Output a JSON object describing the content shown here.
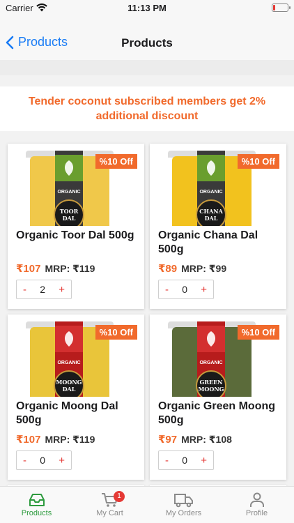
{
  "status": {
    "carrier": "Carrier",
    "time": "11:13 PM"
  },
  "nav": {
    "back_label": "Products",
    "title": "Products"
  },
  "banner": {
    "text": "Tender coconut subscribed members get 2% additional discount"
  },
  "products": [
    {
      "name": "Organic Toor Dal 500g",
      "discount": "%10 Off",
      "price": "₹107",
      "mrp": "MRP: ₹119",
      "qty": "2",
      "bag_label": "TOOR DAL",
      "organic": "ORGANIC",
      "bag_color": "#f0c84a",
      "label_color": "#6a9e2e"
    },
    {
      "name": "Organic Chana Dal 500g",
      "discount": "%10 Off",
      "price": "₹89",
      "mrp": "MRP: ₹99",
      "qty": "0",
      "bag_label": "CHANA DAL",
      "organic": "ORGANIC",
      "bag_color": "#f2c21e",
      "label_color": "#6a9e2e"
    },
    {
      "name": "Organic Moong Dal 500g",
      "discount": "%10 Off",
      "price": "₹107",
      "mrp": "MRP: ₹119",
      "qty": "0",
      "bag_label": "MOONG DAL",
      "organic": "ORGANIC",
      "bag_color": "#e9c53a",
      "label_color": "#d32f2f"
    },
    {
      "name": "Organic Green Moong 500g",
      "discount": "%10 Off",
      "price": "₹97",
      "mrp": "MRP: ₹108",
      "qty": "0",
      "bag_label": "GREEN MOONG",
      "organic": "ORGANIC",
      "bag_color": "#5b6b3a",
      "label_color": "#d32f2f"
    }
  ],
  "stepper": {
    "minus": "-",
    "plus": "+"
  },
  "tabs": [
    {
      "label": "Products",
      "icon": "inbox-icon"
    },
    {
      "label": "My Cart",
      "icon": "cart-icon",
      "badge": "1"
    },
    {
      "label": "My Orders",
      "icon": "truck-icon"
    },
    {
      "label": "Profile",
      "icon": "person-icon"
    }
  ],
  "colors": {
    "accent": "#f16a2c",
    "link": "#1a7cf5",
    "active_tab": "#2e9b3f",
    "stepper_op": "#e53935"
  }
}
